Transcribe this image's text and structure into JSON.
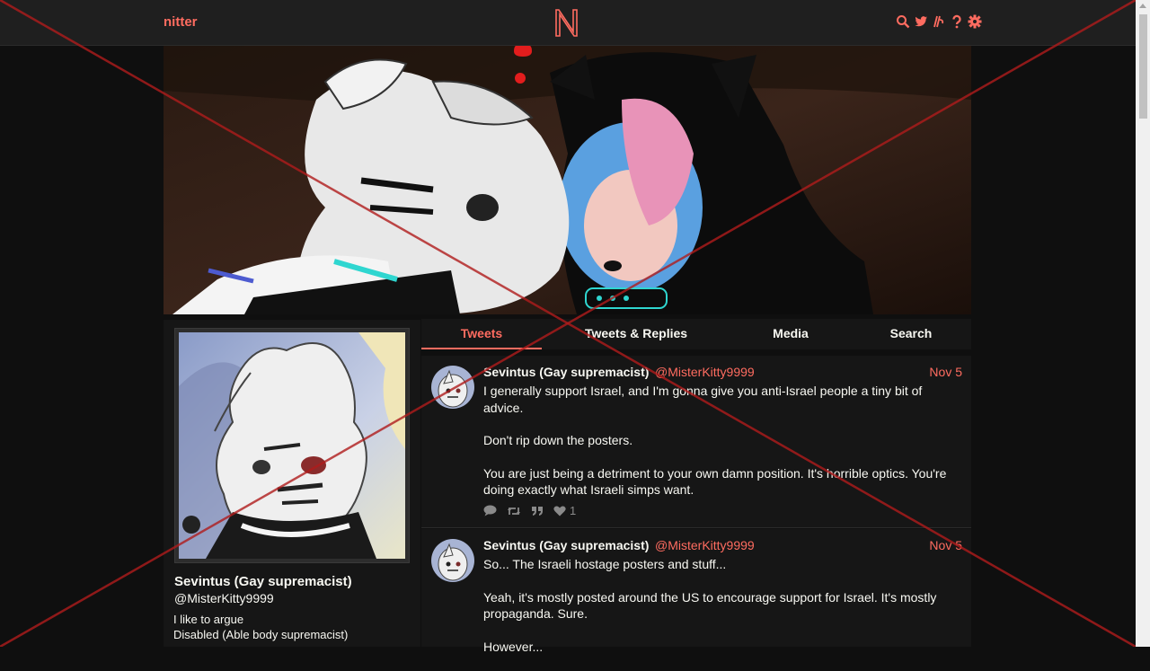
{
  "header": {
    "brand": "nitter",
    "logo_letter": "N",
    "icons": [
      "search-icon",
      "twitter-bird-icon",
      "rss-icon",
      "help-icon",
      "gear-icon"
    ]
  },
  "colors": {
    "accent": "#ff6c60",
    "background": "#0f0f0f",
    "panel": "#161616",
    "navbar": "#1f1f1f",
    "text": "#f8f8f2"
  },
  "profile": {
    "name": "Sevintus (Gay supremacist)",
    "handle": "@MisterKitty9999",
    "bio_line_1": "I like to argue",
    "bio_line_2": "Disabled (Able body supremacist)"
  },
  "tabs": [
    {
      "label": "Tweets",
      "active": true
    },
    {
      "label": "Tweets & Replies",
      "active": false
    },
    {
      "label": "Media",
      "active": false
    },
    {
      "label": "Search",
      "active": false
    }
  ],
  "tweets": [
    {
      "name": "Sevintus (Gay supremacist)",
      "handle": "@MisterKitty9999",
      "date": "Nov 5",
      "paragraphs": [
        "I generally support Israel, and I'm gonna give you anti-Israel people a tiny bit of advice.",
        "Don't rip down the posters.",
        "You are just being a detriment to your own damn position. It's horrible optics. You're doing exactly what Israeli simps want."
      ],
      "likes": "1"
    },
    {
      "name": "Sevintus (Gay supremacist)",
      "handle": "@MisterKitty9999",
      "date": "Nov 5",
      "paragraphs": [
        "So... The Israeli hostage posters and stuff...",
        "Yeah, it's mostly posted around the US to encourage support for Israel. It's mostly propaganda. Sure.",
        "However..."
      ]
    }
  ]
}
